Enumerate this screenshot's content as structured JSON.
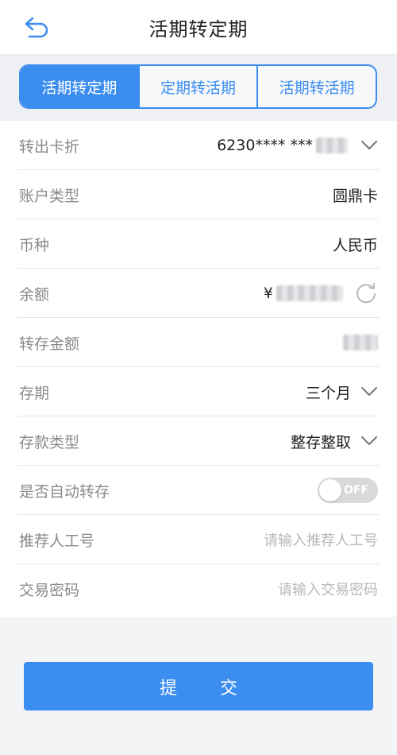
{
  "header": {
    "title": "活期转定期"
  },
  "tabs": [
    "活期转定期",
    "定期转活期",
    "活期转活期"
  ],
  "form": {
    "card": {
      "label": "转出卡折",
      "value": "6230**** ***"
    },
    "account_type": {
      "label": "账户类型",
      "value": "圆鼎卡"
    },
    "currency": {
      "label": "币种",
      "value": "人民币"
    },
    "balance": {
      "label": "余额",
      "symbol": "¥"
    },
    "amount": {
      "label": "转存金额"
    },
    "term": {
      "label": "存期",
      "value": "三个月"
    },
    "deposit_type": {
      "label": "存款类型",
      "value": "整存整取"
    },
    "auto_renew": {
      "label": "是否自动转存",
      "state": "OFF"
    },
    "referrer": {
      "label": "推荐人工号",
      "placeholder": "请输入推荐人工号"
    },
    "password": {
      "label": "交易密码",
      "placeholder": "请输入交易密码"
    }
  },
  "submit": {
    "label": "提交"
  },
  "colors": {
    "accent": "#3c8df0",
    "label_gray": "#8a8a8a",
    "placeholder_gray": "#b8b8b8"
  },
  "icons": [
    "back-arrow-icon",
    "chevron-down-icon",
    "refresh-icon"
  ]
}
